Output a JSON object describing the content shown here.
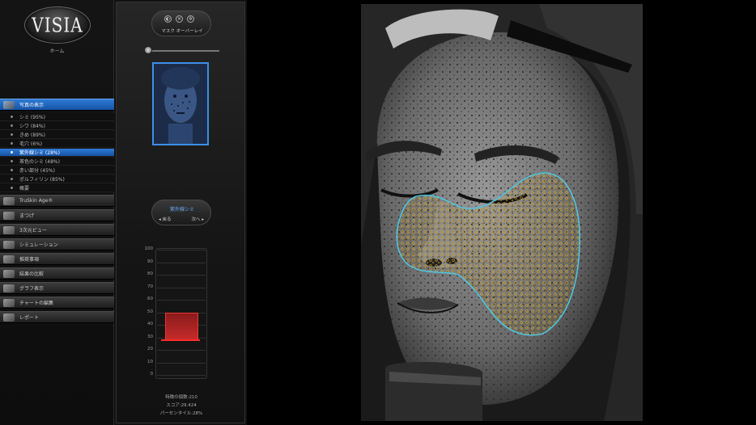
{
  "sidebar": {
    "logo": "VISIA",
    "home_label": "ホーム",
    "sections": [
      {
        "label": "写真の表示",
        "active": true
      },
      {
        "label": "TruSkin Age®",
        "active": false
      },
      {
        "label": "まつげ",
        "active": false
      },
      {
        "label": "3次元ビュー",
        "active": false
      },
      {
        "label": "シミュレーション",
        "active": false
      },
      {
        "label": "推奨事項",
        "active": false
      },
      {
        "label": "結果の比較",
        "active": false
      },
      {
        "label": "グラフ表示",
        "active": false
      },
      {
        "label": "チャートの編集",
        "active": false
      },
      {
        "label": "レポート",
        "active": false
      }
    ],
    "sub_items": [
      {
        "label": "シミ (95%)"
      },
      {
        "label": "シワ (84%)"
      },
      {
        "label": "きめ (89%)"
      },
      {
        "label": "毛穴 (6%)"
      },
      {
        "label": "紫外線シミ (28%)",
        "active": true
      },
      {
        "label": "茶色のシミ (48%)"
      },
      {
        "label": "赤い部分 (45%)"
      },
      {
        "label": "ポルフィリン (85%)"
      },
      {
        "label": "概要"
      }
    ]
  },
  "panel": {
    "mask_overlay_label": "マスク オーバーレイ",
    "feature_title": "紫外線シミ",
    "prev_label": "戻る",
    "next_label": "次へ",
    "gauge": {
      "ticks": [
        "100",
        "90",
        "80",
        "70",
        "60",
        "50",
        "40",
        "30",
        "20",
        "10",
        "0"
      ],
      "percentile": 28,
      "range_low": 28,
      "range_high": 50
    },
    "stats": {
      "feature_count_label": "特徴の個数",
      "feature_count": "210",
      "score_label": "スコア",
      "score": "29.424",
      "percentile_label": "パーセンタイル",
      "percentile": "28%"
    }
  },
  "colors": {
    "accent": "#2f7ad6",
    "gauge_red": "#c62a2a",
    "mask_outline": "#4fc3e0",
    "spot_yellow": "#d6a82a"
  }
}
